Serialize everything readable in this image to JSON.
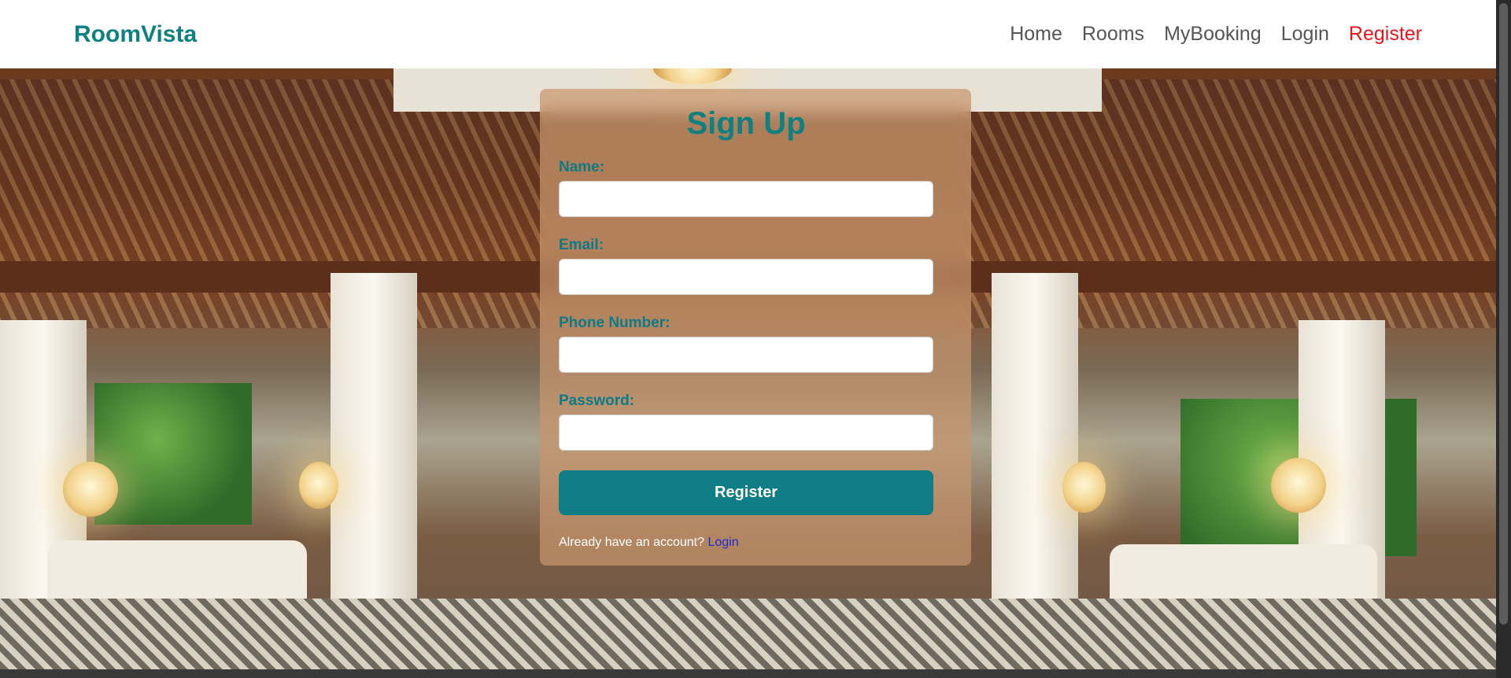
{
  "brand": "RoomVista",
  "nav": {
    "items": [
      {
        "label": "Home"
      },
      {
        "label": "Rooms"
      },
      {
        "label": "MyBooking"
      },
      {
        "label": "Login"
      },
      {
        "label": "Register"
      }
    ],
    "active": "Register",
    "active_color": "#e8161b"
  },
  "form": {
    "title": "Sign Up",
    "fields": {
      "name": {
        "label": "Name:",
        "value": ""
      },
      "email": {
        "label": "Email:",
        "value": ""
      },
      "phone": {
        "label": "Phone Number:",
        "value": ""
      },
      "password": {
        "label": "Password:",
        "value": ""
      }
    },
    "submit_label": "Register",
    "footer_text": "Already have an account?",
    "footer_link": "Login"
  },
  "colors": {
    "accent": "#0e8080",
    "button": "#0e7d86"
  }
}
